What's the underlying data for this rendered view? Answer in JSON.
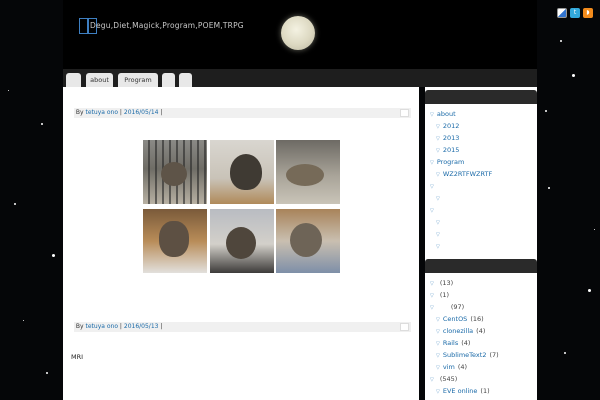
{
  "site": {
    "title": "Degu,Diet,Magick,Program,POEM,TRPG"
  },
  "social": {
    "icons": [
      "delicious-icon",
      "twitter-icon",
      "rss-icon"
    ]
  },
  "nav": {
    "tabs": [
      "",
      "about",
      "Program",
      "",
      ""
    ]
  },
  "posts": [
    {
      "by": "By",
      "author": "tetuya ono",
      "sep": "|",
      "date": "2016/05/14",
      "sep2": "|"
    },
    {
      "by": "By",
      "author": "tetuya ono",
      "sep": "|",
      "date": "2016/05/13",
      "sep2": "|"
    }
  ],
  "post2_text": "MRI",
  "sidebar": {
    "tree": [
      {
        "label": "about",
        "level": 0
      },
      {
        "label": "2012",
        "level": 1
      },
      {
        "label": "2013",
        "level": 1
      },
      {
        "label": "2015",
        "level": 1
      },
      {
        "label": "Program",
        "level": 0
      },
      {
        "label": "WZ2RTFWZRTF",
        "level": 1
      },
      {
        "label": "",
        "level": 0
      },
      {
        "label": "",
        "level": 1
      },
      {
        "label": "",
        "level": 0
      },
      {
        "label": "",
        "level": 1
      },
      {
        "label": "",
        "level": 1
      },
      {
        "label": "",
        "level": 1
      }
    ],
    "categories": [
      {
        "label": "",
        "count": "(13)",
        "level": 0
      },
      {
        "label": "",
        "count": "(1)",
        "level": 0
      },
      {
        "label": "",
        "count": "(97)",
        "level": 0
      },
      {
        "label": "CentOS",
        "count": "(16)",
        "level": 1
      },
      {
        "label": "clonezilla",
        "count": "(4)",
        "level": 1
      },
      {
        "label": "Rails",
        "count": "(4)",
        "level": 1
      },
      {
        "label": "SublimeText2",
        "count": "(7)",
        "level": 1
      },
      {
        "label": "vim",
        "count": "(4)",
        "level": 1
      },
      {
        "label": "",
        "count": "(545)",
        "level": 0
      },
      {
        "label": "EVE online",
        "count": "(1)",
        "level": 1
      }
    ]
  },
  "colors": {
    "link": "#1a6aa8",
    "background": "#050608",
    "logo": "#3e7fc1"
  }
}
